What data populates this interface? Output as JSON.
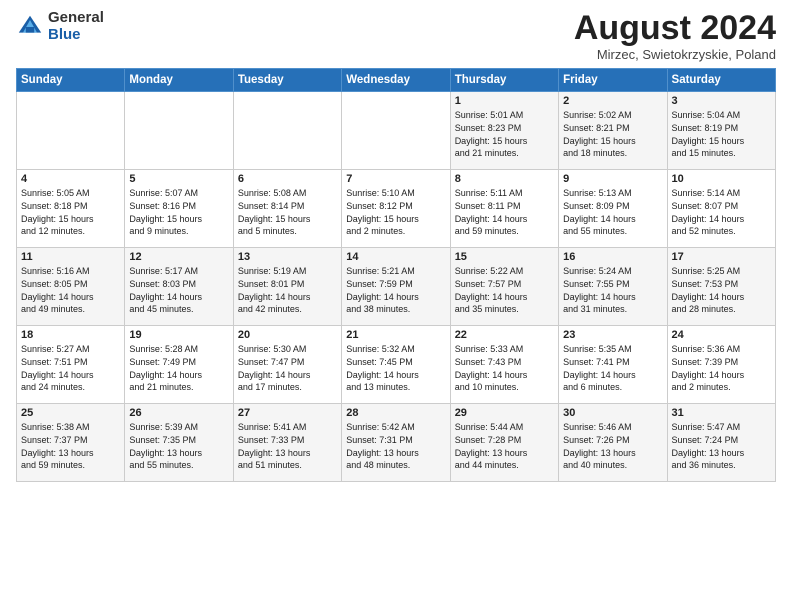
{
  "logo": {
    "general": "General",
    "blue": "Blue"
  },
  "title": "August 2024",
  "subtitle": "Mirzec, Swietokrzyskie, Poland",
  "days_of_week": [
    "Sunday",
    "Monday",
    "Tuesday",
    "Wednesday",
    "Thursday",
    "Friday",
    "Saturday"
  ],
  "weeks": [
    [
      {
        "day": "",
        "info": ""
      },
      {
        "day": "",
        "info": ""
      },
      {
        "day": "",
        "info": ""
      },
      {
        "day": "",
        "info": ""
      },
      {
        "day": "1",
        "info": "Sunrise: 5:01 AM\nSunset: 8:23 PM\nDaylight: 15 hours\nand 21 minutes."
      },
      {
        "day": "2",
        "info": "Sunrise: 5:02 AM\nSunset: 8:21 PM\nDaylight: 15 hours\nand 18 minutes."
      },
      {
        "day": "3",
        "info": "Sunrise: 5:04 AM\nSunset: 8:19 PM\nDaylight: 15 hours\nand 15 minutes."
      }
    ],
    [
      {
        "day": "4",
        "info": "Sunrise: 5:05 AM\nSunset: 8:18 PM\nDaylight: 15 hours\nand 12 minutes."
      },
      {
        "day": "5",
        "info": "Sunrise: 5:07 AM\nSunset: 8:16 PM\nDaylight: 15 hours\nand 9 minutes."
      },
      {
        "day": "6",
        "info": "Sunrise: 5:08 AM\nSunset: 8:14 PM\nDaylight: 15 hours\nand 5 minutes."
      },
      {
        "day": "7",
        "info": "Sunrise: 5:10 AM\nSunset: 8:12 PM\nDaylight: 15 hours\nand 2 minutes."
      },
      {
        "day": "8",
        "info": "Sunrise: 5:11 AM\nSunset: 8:11 PM\nDaylight: 14 hours\nand 59 minutes."
      },
      {
        "day": "9",
        "info": "Sunrise: 5:13 AM\nSunset: 8:09 PM\nDaylight: 14 hours\nand 55 minutes."
      },
      {
        "day": "10",
        "info": "Sunrise: 5:14 AM\nSunset: 8:07 PM\nDaylight: 14 hours\nand 52 minutes."
      }
    ],
    [
      {
        "day": "11",
        "info": "Sunrise: 5:16 AM\nSunset: 8:05 PM\nDaylight: 14 hours\nand 49 minutes."
      },
      {
        "day": "12",
        "info": "Sunrise: 5:17 AM\nSunset: 8:03 PM\nDaylight: 14 hours\nand 45 minutes."
      },
      {
        "day": "13",
        "info": "Sunrise: 5:19 AM\nSunset: 8:01 PM\nDaylight: 14 hours\nand 42 minutes."
      },
      {
        "day": "14",
        "info": "Sunrise: 5:21 AM\nSunset: 7:59 PM\nDaylight: 14 hours\nand 38 minutes."
      },
      {
        "day": "15",
        "info": "Sunrise: 5:22 AM\nSunset: 7:57 PM\nDaylight: 14 hours\nand 35 minutes."
      },
      {
        "day": "16",
        "info": "Sunrise: 5:24 AM\nSunset: 7:55 PM\nDaylight: 14 hours\nand 31 minutes."
      },
      {
        "day": "17",
        "info": "Sunrise: 5:25 AM\nSunset: 7:53 PM\nDaylight: 14 hours\nand 28 minutes."
      }
    ],
    [
      {
        "day": "18",
        "info": "Sunrise: 5:27 AM\nSunset: 7:51 PM\nDaylight: 14 hours\nand 24 minutes."
      },
      {
        "day": "19",
        "info": "Sunrise: 5:28 AM\nSunset: 7:49 PM\nDaylight: 14 hours\nand 21 minutes."
      },
      {
        "day": "20",
        "info": "Sunrise: 5:30 AM\nSunset: 7:47 PM\nDaylight: 14 hours\nand 17 minutes."
      },
      {
        "day": "21",
        "info": "Sunrise: 5:32 AM\nSunset: 7:45 PM\nDaylight: 14 hours\nand 13 minutes."
      },
      {
        "day": "22",
        "info": "Sunrise: 5:33 AM\nSunset: 7:43 PM\nDaylight: 14 hours\nand 10 minutes."
      },
      {
        "day": "23",
        "info": "Sunrise: 5:35 AM\nSunset: 7:41 PM\nDaylight: 14 hours\nand 6 minutes."
      },
      {
        "day": "24",
        "info": "Sunrise: 5:36 AM\nSunset: 7:39 PM\nDaylight: 14 hours\nand 2 minutes."
      }
    ],
    [
      {
        "day": "25",
        "info": "Sunrise: 5:38 AM\nSunset: 7:37 PM\nDaylight: 13 hours\nand 59 minutes."
      },
      {
        "day": "26",
        "info": "Sunrise: 5:39 AM\nSunset: 7:35 PM\nDaylight: 13 hours\nand 55 minutes."
      },
      {
        "day": "27",
        "info": "Sunrise: 5:41 AM\nSunset: 7:33 PM\nDaylight: 13 hours\nand 51 minutes."
      },
      {
        "day": "28",
        "info": "Sunrise: 5:42 AM\nSunset: 7:31 PM\nDaylight: 13 hours\nand 48 minutes."
      },
      {
        "day": "29",
        "info": "Sunrise: 5:44 AM\nSunset: 7:28 PM\nDaylight: 13 hours\nand 44 minutes."
      },
      {
        "day": "30",
        "info": "Sunrise: 5:46 AM\nSunset: 7:26 PM\nDaylight: 13 hours\nand 40 minutes."
      },
      {
        "day": "31",
        "info": "Sunrise: 5:47 AM\nSunset: 7:24 PM\nDaylight: 13 hours\nand 36 minutes."
      }
    ]
  ]
}
